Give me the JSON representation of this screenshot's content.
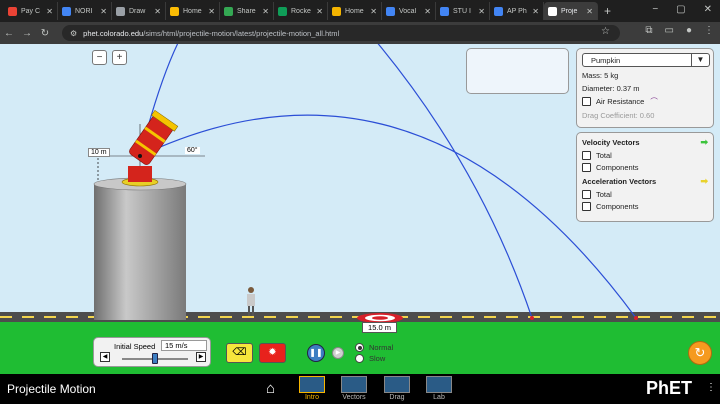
{
  "browser": {
    "tabs": [
      {
        "title": "Pay C",
        "color": "#ea4335"
      },
      {
        "title": "NORI",
        "color": "#4285f4"
      },
      {
        "title": "Draw",
        "color": "#9aa0a6"
      },
      {
        "title": "Home",
        "color": "#fbbc04"
      },
      {
        "title": "Share",
        "color": "#34a853"
      },
      {
        "title": "Rocke",
        "color": "#0f9d58"
      },
      {
        "title": "Home",
        "color": "#f4b400"
      },
      {
        "title": "Vocal",
        "color": "#4285f4"
      },
      {
        "title": "STU I",
        "color": "#4285f4"
      },
      {
        "title": "AP Ph",
        "color": "#4285f4"
      },
      {
        "title": "Proje",
        "color": "#ffffff"
      }
    ],
    "url_host": "phet.colorado.edu",
    "url_path": "/sims/html/projectile-motion/latest/projectile-motion_all.html"
  },
  "projectile": {
    "selected": "Pumpkin",
    "mass": "Mass: 5 kg",
    "diameter": "Diameter: 0.37 m",
    "air_resistance_label": "Air Resistance",
    "drag_coefficient": "Drag Coefficient: 0.60"
  },
  "vectors": {
    "velocity_title": "Velocity Vectors",
    "acceleration_title": "Acceleration Vectors",
    "total_label": "Total",
    "components_label": "Components"
  },
  "controls": {
    "initial_speed_label": "Initial Speed",
    "initial_speed_value": "15 m/s",
    "initial_speed_fraction": 0.5,
    "normal_label": "Normal",
    "slow_label": "Slow",
    "selected_speed": "Normal"
  },
  "scene": {
    "height_label": "10 m",
    "angle_label": "60°",
    "target_distance": "15.0 m"
  },
  "navbar": {
    "app_title": "Projectile Motion",
    "screens": [
      "Intro",
      "Vectors",
      "Drag",
      "Lab"
    ],
    "active_screen": "Intro",
    "brand": "PhET"
  }
}
